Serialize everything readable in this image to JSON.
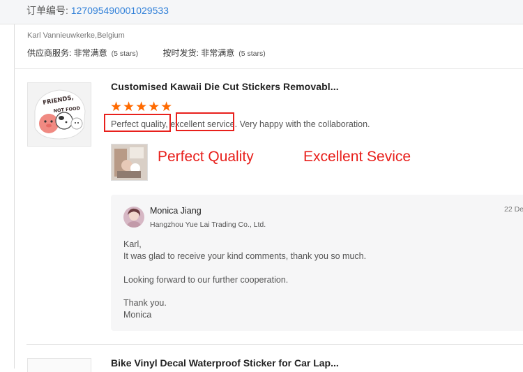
{
  "order": {
    "label": "订单编号: ",
    "number": "127095490001029533"
  },
  "reviewer": {
    "name_location": "Karl Vannieuwkerke,Belgium"
  },
  "ratings": [
    {
      "label": "供应商服务: 非常满意",
      "stars_text": "(5 stars)"
    },
    {
      "label": "按时发货: 非常满意",
      "stars_text": "(5 stars)"
    }
  ],
  "review": {
    "product_title": "Customised Kawaii Die Cut Stickers Removabl...",
    "thumbnail_text": "FRIENDS, NOT FOOD",
    "star_count": 5,
    "star_glyphs": "★★★★★",
    "text": "Perfect quality, excellent service. Very happy with the collaboration.",
    "star_color": "#ff6a00"
  },
  "annotations": {
    "left": "Perfect Quality",
    "right": "Excellent Sevice",
    "color": "#e8201c"
  },
  "reply": {
    "name": "Monica Jiang",
    "company": "Hangzhou Yue Lai Trading Co., Ltd.",
    "date": "22 De",
    "lines": [
      "Karl,",
      "It was glad to receive your kind comments, thank you so much.",
      "Looking forward to our further cooperation.",
      "Thank you.",
      "Monica"
    ]
  },
  "next_review": {
    "product_title": "Bike Vinyl Decal Waterproof Sticker for Car Lap..."
  }
}
